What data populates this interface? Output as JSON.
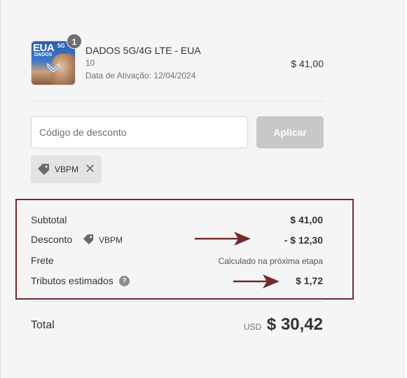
{
  "product": {
    "title": "DADOS 5G/4G LTE - EUA",
    "variant": "10",
    "activation": "Data de Ativação: 12/04/2024",
    "price": "$ 41,00",
    "quantity": "1",
    "thumb_text": "EUA",
    "thumb_5g": "5G",
    "thumb_dados": "DADOS"
  },
  "discount": {
    "placeholder": "Código de desconto",
    "apply_label": "Aplicar",
    "applied_code": "VBPM",
    "remove_symbol": "✕"
  },
  "summary": {
    "subtotal_label": "Subtotal",
    "subtotal_value": "$ 41,00",
    "discount_label": "Desconto",
    "discount_code": "VBPM",
    "discount_value": "- $ 12,30",
    "shipping_label": "Frete",
    "shipping_value": "Calculado na próxima etapa",
    "taxes_label": "Tributos estimados",
    "taxes_help": "?",
    "taxes_value": "$ 1,72"
  },
  "total": {
    "label": "Total",
    "currency": "USD",
    "value": "$ 30,42"
  },
  "colors": {
    "highlight": "#722c2c",
    "button_disabled": "#c8c8c8",
    "badge": "#6f6f6f"
  },
  "icons": [
    "tag-icon",
    "close-icon",
    "help-icon",
    "arrow-right-icon"
  ]
}
